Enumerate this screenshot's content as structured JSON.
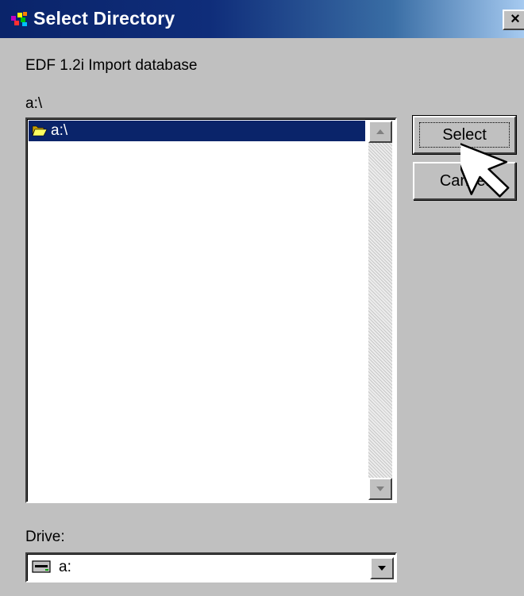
{
  "window": {
    "title": "Select Directory",
    "close_label": "×",
    "title_icon": "app-icon"
  },
  "dialog": {
    "description": "EDF 1.2i Import database",
    "current_path": "a:\\"
  },
  "directory_list": {
    "items": [
      {
        "label": "a:\\",
        "icon": "open-folder-icon",
        "selected": true
      }
    ]
  },
  "buttons": {
    "select_label": "Select",
    "cancel_label": "Cancel"
  },
  "drive": {
    "label": "Drive:",
    "value": "a:",
    "icon": "floppy-drive-icon"
  },
  "colors": {
    "titlebar_start": "#0a246a",
    "titlebar_end": "#a6caf0",
    "selection": "#0a246a",
    "face": "#c0c0c0"
  }
}
